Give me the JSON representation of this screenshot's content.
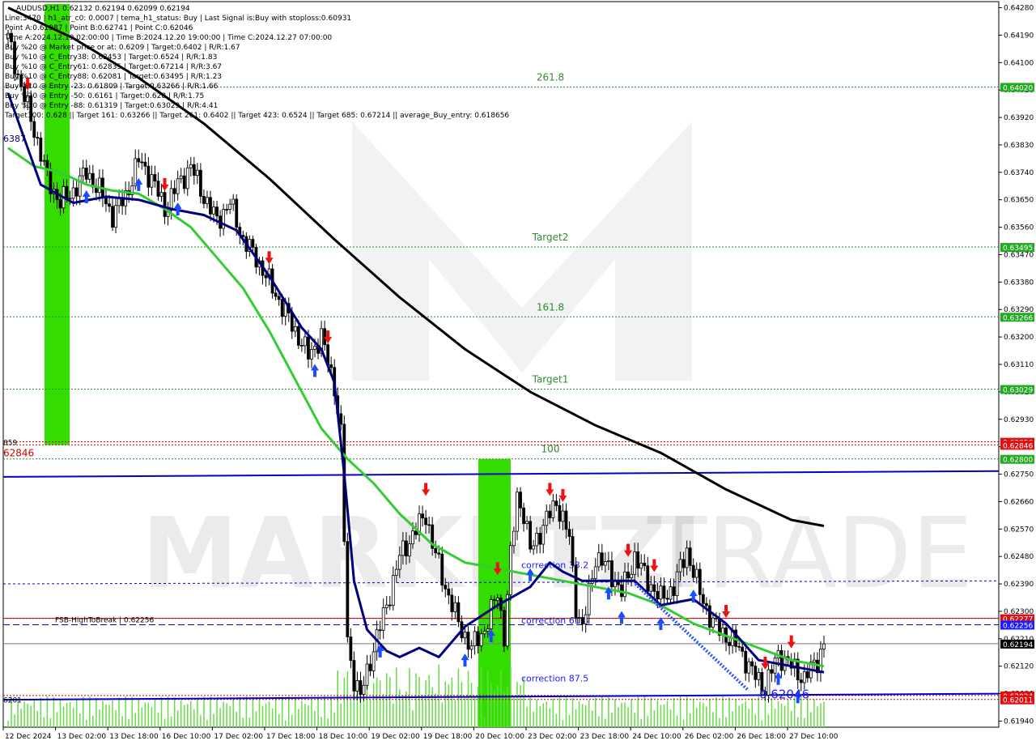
{
  "header": {
    "lines": [
      "AUDUSD,H1  0.62132 0.62194 0.62099 0.62194",
      "Line:3470  |  h1_atr_c0: 0.0007  |  tema_h1_status: Buy  |  Last Signal is:Buy with stoploss:0.60931",
      "Point A:0.61987  |  Point B:0.62741  |  Point C:0.62046",
      "Time A:2024.12.19 02:00:00  |  Time B:2024.12.20 19:00:00  |  Time C:2024.12.27 07:00:00",
      "Buy %20 @ Market price or at: 0.6209  |  Target:0.6402  |  R/R:1.67",
      "Buy %10 @ C_Entry38: 0.62453  |  Target:0.6524  |  R/R:1.83",
      "Buy %10 @ C_Entry61: 0.62835  |  Target:0.67214  |  R/R:3.67",
      "Buy %10 @ C_Entry88: 0.62081  |  Target:0.63495  |  R/R:1.23",
      "Buy %10 @ Entry -23: 0.61809  |  Target:0.63266  |  R/R:1.66",
      "Buy %20 @ Entry -50: 0.6161  |  Target:0.628  |  R/R:1.75",
      "Buy %20 @ Entry -88: 0.61319  |  Target:0.63029  |  R/R:4.41",
      "Target100: 0.628  ||  Target 161: 0.63266  ||  Target 261: 0.6402  ||  Target 423: 0.6524  ||  Target 685: 0.67214  ||  average_Buy_entry: 0.618656"
    ]
  },
  "watermark": {
    "left": "MARKETZI",
    "right": "TRADE"
  },
  "colors": {
    "up_candle": "#000000",
    "down_candle": "#000000",
    "ma_fast": "#000080",
    "ma_mid": "#33cc33",
    "ma_slow": "#000000",
    "level_green": "#2e8b2e",
    "level_red": "#cc0000",
    "level_blue": "#0000cc",
    "tag_green": "#22aa22",
    "tag_red": "#dd1111",
    "tag_blue": "#1a1aff",
    "tag_current": "#000000",
    "zone_green": "#33dd00"
  },
  "chart_data": {
    "type": "candlestick",
    "symbol": "AUDUSD",
    "timeframe": "H1",
    "ylim": [
      0.6192,
      0.643
    ],
    "y_ticks": [
      "0.64280",
      "0.64190",
      "0.64100",
      "0.64010",
      "0.63920",
      "0.63830",
      "0.63740",
      "0.63650",
      "0.63560",
      "0.63470",
      "0.63380",
      "0.63290",
      "0.63200",
      "0.63110",
      "0.63020",
      "0.62930",
      "0.62840",
      "0.62750",
      "0.62660",
      "0.62570",
      "0.62480",
      "0.62390",
      "0.62300",
      "0.62210",
      "0.62120",
      "0.62030",
      "0.61940"
    ],
    "x_ticks": [
      "12 Dec 2024",
      "13 Dec 02:00",
      "13 Dec 18:00",
      "16 Dec 10:00",
      "17 Dec 02:00",
      "17 Dec 18:00",
      "18 Dec 10:00",
      "19 Dec 02:00",
      "19 Dec 18:00",
      "20 Dec 10:00",
      "23 Dec 02:00",
      "23 Dec 18:00",
      "24 Dec 10:00",
      "26 Dec 02:00",
      "26 Dec 18:00",
      "27 Dec 10:00"
    ],
    "close_path": [
      [
        0,
        0.6418
      ],
      [
        4,
        0.6402
      ],
      [
        8,
        0.6388
      ],
      [
        12,
        0.6372
      ],
      [
        16,
        0.6364
      ],
      [
        20,
        0.6368
      ],
      [
        24,
        0.6374
      ],
      [
        28,
        0.6368
      ],
      [
        32,
        0.636
      ],
      [
        36,
        0.6366
      ],
      [
        40,
        0.6378
      ],
      [
        44,
        0.6372
      ],
      [
        48,
        0.6362
      ],
      [
        52,
        0.637
      ],
      [
        56,
        0.6376
      ],
      [
        60,
        0.6366
      ],
      [
        64,
        0.6358
      ],
      [
        68,
        0.6364
      ],
      [
        72,
        0.6352
      ],
      [
        76,
        0.6346
      ],
      [
        80,
        0.6338
      ],
      [
        84,
        0.633
      ],
      [
        88,
        0.6322
      ],
      [
        92,
        0.6314
      ],
      [
        96,
        0.632
      ],
      [
        100,
        0.6304
      ],
      [
        102,
        0.6288
      ],
      [
        104,
        0.622
      ],
      [
        106,
        0.6208
      ],
      [
        108,
        0.6202
      ],
      [
        112,
        0.6218
      ],
      [
        116,
        0.6232
      ],
      [
        120,
        0.6248
      ],
      [
        124,
        0.6255
      ],
      [
        128,
        0.6262
      ],
      [
        130,
        0.6252
      ],
      [
        134,
        0.6238
      ],
      [
        138,
        0.6226
      ],
      [
        142,
        0.6218
      ],
      [
        146,
        0.6224
      ],
      [
        150,
        0.6236
      ],
      [
        152,
        0.6222
      ],
      [
        154,
        0.6248
      ],
      [
        156,
        0.6268
      ],
      [
        158,
        0.6262
      ],
      [
        160,
        0.625
      ],
      [
        164,
        0.6258
      ],
      [
        168,
        0.6266
      ],
      [
        172,
        0.6254
      ],
      [
        174,
        0.6232
      ],
      [
        176,
        0.6224
      ],
      [
        180,
        0.6248
      ],
      [
        184,
        0.6244
      ],
      [
        188,
        0.6236
      ],
      [
        192,
        0.6248
      ],
      [
        196,
        0.624
      ],
      [
        200,
        0.6234
      ],
      [
        204,
        0.6238
      ],
      [
        208,
        0.625
      ],
      [
        212,
        0.6236
      ],
      [
        216,
        0.6226
      ],
      [
        220,
        0.6222
      ],
      [
        224,
        0.6218
      ],
      [
        228,
        0.621
      ],
      [
        232,
        0.6205
      ],
      [
        236,
        0.6216
      ],
      [
        240,
        0.6212
      ],
      [
        244,
        0.6208
      ],
      [
        248,
        0.6214
      ],
      [
        250,
        0.62194
      ]
    ],
    "moving_averages": {
      "fast_tema": [
        [
          0,
          0.64
        ],
        [
          10,
          0.637
        ],
        [
          20,
          0.6364
        ],
        [
          30,
          0.6366
        ],
        [
          40,
          0.6365
        ],
        [
          50,
          0.6362
        ],
        [
          60,
          0.636
        ],
        [
          70,
          0.6355
        ],
        [
          80,
          0.634
        ],
        [
          90,
          0.6323
        ],
        [
          96,
          0.6316
        ],
        [
          100,
          0.6305
        ],
        [
          103,
          0.6275
        ],
        [
          106,
          0.624
        ],
        [
          110,
          0.6224
        ],
        [
          116,
          0.6217
        ],
        [
          120,
          0.6215
        ],
        [
          126,
          0.6218
        ],
        [
          132,
          0.6215
        ],
        [
          140,
          0.6225
        ],
        [
          150,
          0.6232
        ],
        [
          160,
          0.6238
        ],
        [
          166,
          0.6246
        ],
        [
          170,
          0.6243
        ],
        [
          176,
          0.624
        ],
        [
          184,
          0.624
        ],
        [
          192,
          0.624
        ],
        [
          200,
          0.6232
        ],
        [
          210,
          0.6234
        ],
        [
          220,
          0.6226
        ],
        [
          230,
          0.6214
        ],
        [
          240,
          0.6212
        ],
        [
          250,
          0.621
        ]
      ],
      "mid_ma": [
        [
          0,
          0.6382
        ],
        [
          8,
          0.6376
        ],
        [
          16,
          0.6374
        ],
        [
          24,
          0.637
        ],
        [
          32,
          0.6368
        ],
        [
          40,
          0.6367
        ],
        [
          48,
          0.6362
        ],
        [
          56,
          0.6356
        ],
        [
          64,
          0.6346
        ],
        [
          72,
          0.6336
        ],
        [
          80,
          0.6322
        ],
        [
          88,
          0.6306
        ],
        [
          96,
          0.629
        ],
        [
          104,
          0.628
        ],
        [
          112,
          0.6272
        ],
        [
          120,
          0.6262
        ],
        [
          130,
          0.6252
        ],
        [
          140,
          0.6246
        ],
        [
          150,
          0.6244
        ],
        [
          160,
          0.6242
        ],
        [
          170,
          0.624
        ],
        [
          180,
          0.6238
        ],
        [
          190,
          0.6236
        ],
        [
          200,
          0.6232
        ],
        [
          210,
          0.6226
        ],
        [
          220,
          0.6222
        ],
        [
          230,
          0.6218
        ],
        [
          240,
          0.6214
        ],
        [
          250,
          0.6212
        ]
      ],
      "slow_ma": [
        [
          0,
          0.6428
        ],
        [
          20,
          0.6418
        ],
        [
          40,
          0.6405
        ],
        [
          60,
          0.639
        ],
        [
          80,
          0.6372
        ],
        [
          100,
          0.6352
        ],
        [
          120,
          0.6333
        ],
        [
          140,
          0.6316
        ],
        [
          160,
          0.6302
        ],
        [
          180,
          0.6291
        ],
        [
          200,
          0.6282
        ],
        [
          220,
          0.627
        ],
        [
          240,
          0.626
        ],
        [
          250,
          0.6258
        ]
      ]
    },
    "levels": [
      {
        "label": "261.8",
        "price": 0.6402,
        "tag": "0.64020",
        "kind": "green"
      },
      {
        "label": "Target2",
        "price": 0.63495,
        "tag": "0.63495",
        "kind": "green"
      },
      {
        "label": "161.8",
        "price": 0.63266,
        "tag": "0.63266",
        "kind": "green"
      },
      {
        "label": "Target1",
        "price": 0.63029,
        "tag": "0.63029",
        "kind": "green"
      },
      {
        "label": "100",
        "price": 0.628,
        "tag": "0.62800",
        "kind": "green"
      },
      {
        "label": "",
        "price": 0.62856,
        "tag": "0.62856",
        "kind": "red"
      },
      {
        "label": "",
        "price": 0.62846,
        "tag": "0.62846",
        "kind": "red"
      },
      {
        "label": "",
        "price": 0.62277,
        "tag": "0.62277",
        "kind": "red"
      },
      {
        "label": "",
        "price": 0.62256,
        "tag": "0.62256",
        "kind": "blue"
      },
      {
        "label": "",
        "price": 0.62024,
        "tag": "0.62024",
        "kind": "red"
      },
      {
        "label": "",
        "price": 0.62011,
        "tag": "0.62011",
        "kind": "red"
      },
      {
        "label": "",
        "price": 0.62194,
        "tag": "0.62194",
        "kind": "current"
      }
    ],
    "corrections": [
      {
        "label": "correction 38.2",
        "price": 0.62453
      },
      {
        "label": "correction 61.8",
        "price": 0.6227
      },
      {
        "label": "correction 87.5",
        "price": 0.62081
      }
    ],
    "annotations": {
      "fsb": "FSB-HighToBreak  |  0.62256",
      "point_c": "0.62046",
      "left_label_1": "859",
      "left_label_2": "62846",
      "left_label_3": "6387",
      "left_label_4": "6201"
    }
  }
}
